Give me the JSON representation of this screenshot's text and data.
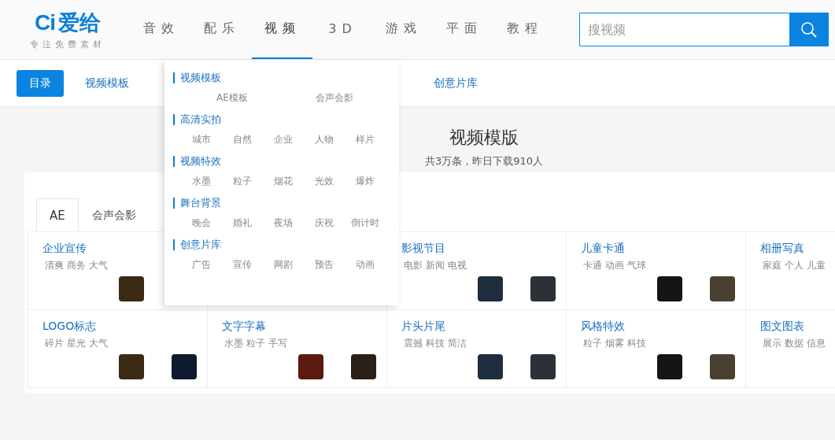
{
  "logo": {
    "mark": "Ci",
    "name": "爱给",
    "tagline": "专注免费素材"
  },
  "nav": [
    {
      "label": "音效",
      "selected": false
    },
    {
      "label": "配乐",
      "selected": false
    },
    {
      "label": "视频",
      "selected": true
    },
    {
      "label": "3D",
      "selected": false
    },
    {
      "label": "游戏",
      "selected": false
    },
    {
      "label": "平面",
      "selected": false
    },
    {
      "label": "教程",
      "selected": false
    }
  ],
  "search": {
    "placeholder": "搜视频"
  },
  "subnav": [
    {
      "label": "目录",
      "selected": true
    },
    {
      "label": "视频模板",
      "selected": false
    },
    {
      "label": "创意片库",
      "selected": false
    }
  ],
  "heading": {
    "title": "视频模版",
    "subtitle": "共3万条，昨日下载910人"
  },
  "tabs": [
    {
      "label": "AE",
      "selected": true
    },
    {
      "label": "会声会影",
      "selected": false
    }
  ],
  "cards": [
    {
      "title": "企业宣传",
      "tags": "清爽 商务 大气"
    },
    {
      "covered": true
    },
    {
      "title": "影视节目",
      "tags": "电影 新闻 电视"
    },
    {
      "title": "儿童卡通",
      "tags": "卡通 动画 气球"
    },
    {
      "title": "相册写真",
      "tags": "家庭 个人 儿童"
    },
    {
      "title": "LOGO标志",
      "tags": "碎片 星光 大气"
    },
    {
      "title": "文字字幕",
      "tags": "水墨 粒子 手写"
    },
    {
      "title": "片头片尾",
      "tags": "震撼 科技 简洁"
    },
    {
      "title": "风格特效",
      "tags": "粒子 烟雾 科技"
    },
    {
      "title": "图文图表",
      "tags": "展示 数据 信息"
    }
  ],
  "menu": [
    {
      "heading": "视频模板",
      "items": [
        "AE模板",
        "会声会影"
      ]
    },
    {
      "heading": "高清实拍",
      "items": [
        "城市",
        "自然",
        "企业",
        "人物",
        "样片"
      ]
    },
    {
      "heading": "视频特效",
      "items": [
        "水墨",
        "粒子",
        "烟花",
        "光效",
        "爆炸"
      ]
    },
    {
      "heading": "舞台背景",
      "items": [
        "晚会",
        "婚礼",
        "夜场",
        "庆祝",
        "倒计时"
      ]
    },
    {
      "heading": "创意片库",
      "items": [
        "广告",
        "宣传",
        "网剧",
        "预告",
        "动画"
      ]
    }
  ]
}
